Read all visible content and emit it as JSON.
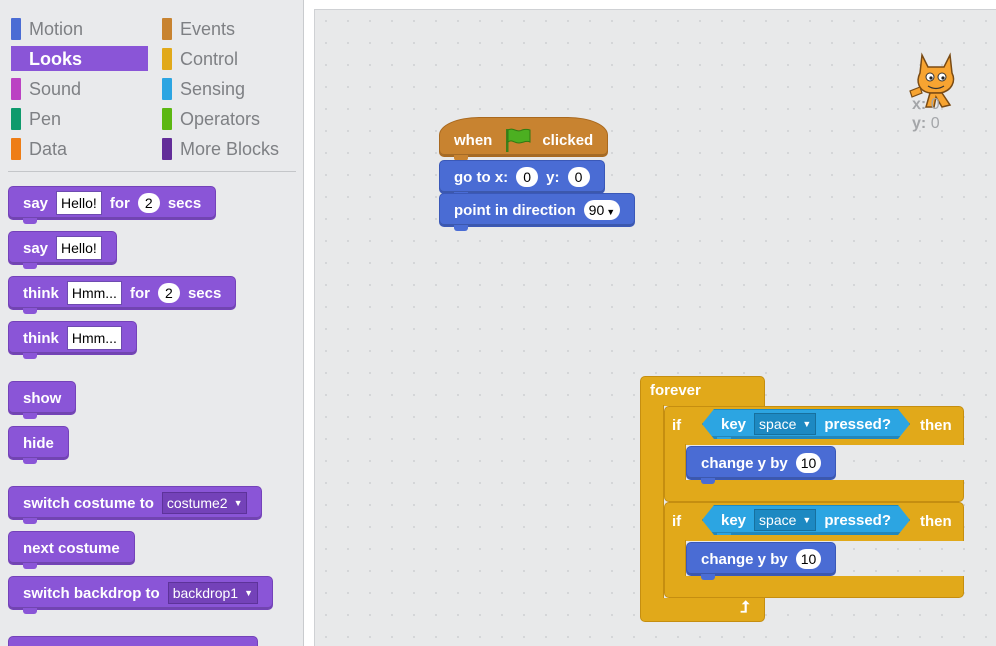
{
  "categories": {
    "left": [
      {
        "label": "Motion",
        "color": "#4a6cd4"
      },
      {
        "label": "Looks",
        "color": "#8a55d7",
        "active": true
      },
      {
        "label": "Sound",
        "color": "#bb42c3"
      },
      {
        "label": "Pen",
        "color": "#0e9a6c"
      },
      {
        "label": "Data",
        "color": "#ee7d16"
      }
    ],
    "right": [
      {
        "label": "Events",
        "color": "#c88330"
      },
      {
        "label": "Control",
        "color": "#e1a91a"
      },
      {
        "label": "Sensing",
        "color": "#2ca5e2"
      },
      {
        "label": "Operators",
        "color": "#5cb712"
      },
      {
        "label": "More Blocks",
        "color": "#632d99"
      }
    ]
  },
  "palette_blocks": {
    "say_for": {
      "say": "say",
      "text": "Hello!",
      "for": "for",
      "secs_value": "2",
      "secs": "secs"
    },
    "say": {
      "say": "say",
      "text": "Hello!"
    },
    "think_for": {
      "think": "think",
      "text": "Hmm...",
      "for": "for",
      "secs_value": "2",
      "secs": "secs"
    },
    "think": {
      "think": "think",
      "text": "Hmm..."
    },
    "show": "show",
    "hide": "hide",
    "switch_costume": {
      "label": "switch costume to",
      "value": "costume2"
    },
    "next_costume": "next costume",
    "switch_backdrop": {
      "label": "switch backdrop to",
      "value": "backdrop1"
    }
  },
  "script": {
    "hat": {
      "when": "when",
      "clicked": "clicked"
    },
    "goto": {
      "go_to_x": "go to x:",
      "x": "0",
      "y_label": "y:",
      "y": "0"
    },
    "point": {
      "label": "point in direction",
      "value": "90"
    },
    "forever": "forever",
    "if_blocks": [
      {
        "if": "if",
        "key": "key",
        "key_value": "space",
        "pressed": "pressed?",
        "then": "then",
        "change": "change y by",
        "amount": "10"
      },
      {
        "if": "if",
        "key": "key",
        "key_value": "space",
        "pressed": "pressed?",
        "then": "then",
        "change": "change y by",
        "amount": "10"
      }
    ]
  },
  "sprite": {
    "x_label": "x:",
    "x": "0",
    "y_label": "y:",
    "y": "0"
  },
  "colors": {
    "looks": "#8a55d7",
    "motion": "#4a6cd4",
    "events": "#c88330",
    "control": "#e1a91a",
    "sensing": "#2ca5e2",
    "flag": "#4caf21"
  }
}
